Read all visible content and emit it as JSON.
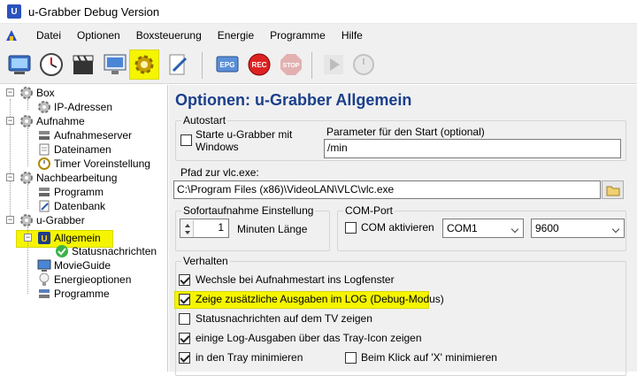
{
  "window": {
    "title": "u-Grabber Debug Version",
    "app_icon_text": "U"
  },
  "menu": [
    "Datei",
    "Optionen",
    "Boxsteuerung",
    "Energie",
    "Programme",
    "Hilfe"
  ],
  "toolbar": {
    "buttons": [
      {
        "name": "box-tv-icon"
      },
      {
        "name": "clock-icon"
      },
      {
        "name": "clapperboard-icon"
      },
      {
        "name": "monitor-icon"
      },
      {
        "name": "gear-icon",
        "selected": true
      },
      {
        "name": "pen-icon"
      },
      {
        "name": "epg-icon",
        "label": "EPG"
      },
      {
        "name": "rec-icon",
        "label": "REC"
      },
      {
        "name": "stop-icon",
        "label": "STOP"
      },
      {
        "name": "play-icon"
      },
      {
        "name": "timer-icon"
      }
    ],
    "highlight_color": "#f5f500"
  },
  "tree": {
    "items": [
      {
        "label": "Box"
      },
      {
        "label": "IP-Adressen"
      },
      {
        "label": "Aufnahme"
      },
      {
        "label": "Aufnahmeserver"
      },
      {
        "label": "Dateinamen"
      },
      {
        "label": "Timer Voreinstellung"
      },
      {
        "label": "Nachbearbeitung"
      },
      {
        "label": "Programm"
      },
      {
        "label": "Datenbank"
      },
      {
        "label": "u-Grabber"
      },
      {
        "label": "Allgemein",
        "selected": true
      },
      {
        "label": "Statusnachrichten"
      },
      {
        "label": "MovieGuide"
      },
      {
        "label": "Energieoptionen"
      },
      {
        "label": "Programme"
      }
    ]
  },
  "options": {
    "title": "Optionen: u-Grabber Allgemein",
    "autostart": {
      "group_label": "Autostart",
      "checkbox_label_line1": "Starte u-Grabber mit",
      "checkbox_label_line2": "Windows",
      "checked": false,
      "param_label": "Parameter für den Start (optional)",
      "param_value": "/min"
    },
    "vlc": {
      "label": "Pfad zur vlc.exe:",
      "value": "C:\\Program Files (x86)\\VideoLAN\\VLC\\vlc.exe"
    },
    "sofort": {
      "group_label": "Sofortaufnahme Einstellung",
      "value": "1",
      "unit_label": "Minuten Länge"
    },
    "com": {
      "group_label": "COM-Port",
      "checkbox_label": "COM aktivieren",
      "checked": false,
      "port": "COM1",
      "baud": "9600"
    },
    "verhalten": {
      "group_label": "Verhalten",
      "items": [
        {
          "label": "Wechsle bei Aufnahmestart ins Logfenster",
          "checked": true
        },
        {
          "label": "Zeige zusätzliche Ausgaben im LOG (Debug-Modus)",
          "checked": true,
          "highlighted": true
        },
        {
          "label": "Statusnachrichten auf dem TV zeigen",
          "checked": false
        },
        {
          "label": "einige Log-Ausgaben über das Tray-Icon zeigen",
          "checked": true
        },
        {
          "label": "in den Tray minimieren",
          "checked": true
        }
      ],
      "extra": {
        "label": "Beim Klick auf 'X' minimieren",
        "checked": false
      }
    }
  }
}
